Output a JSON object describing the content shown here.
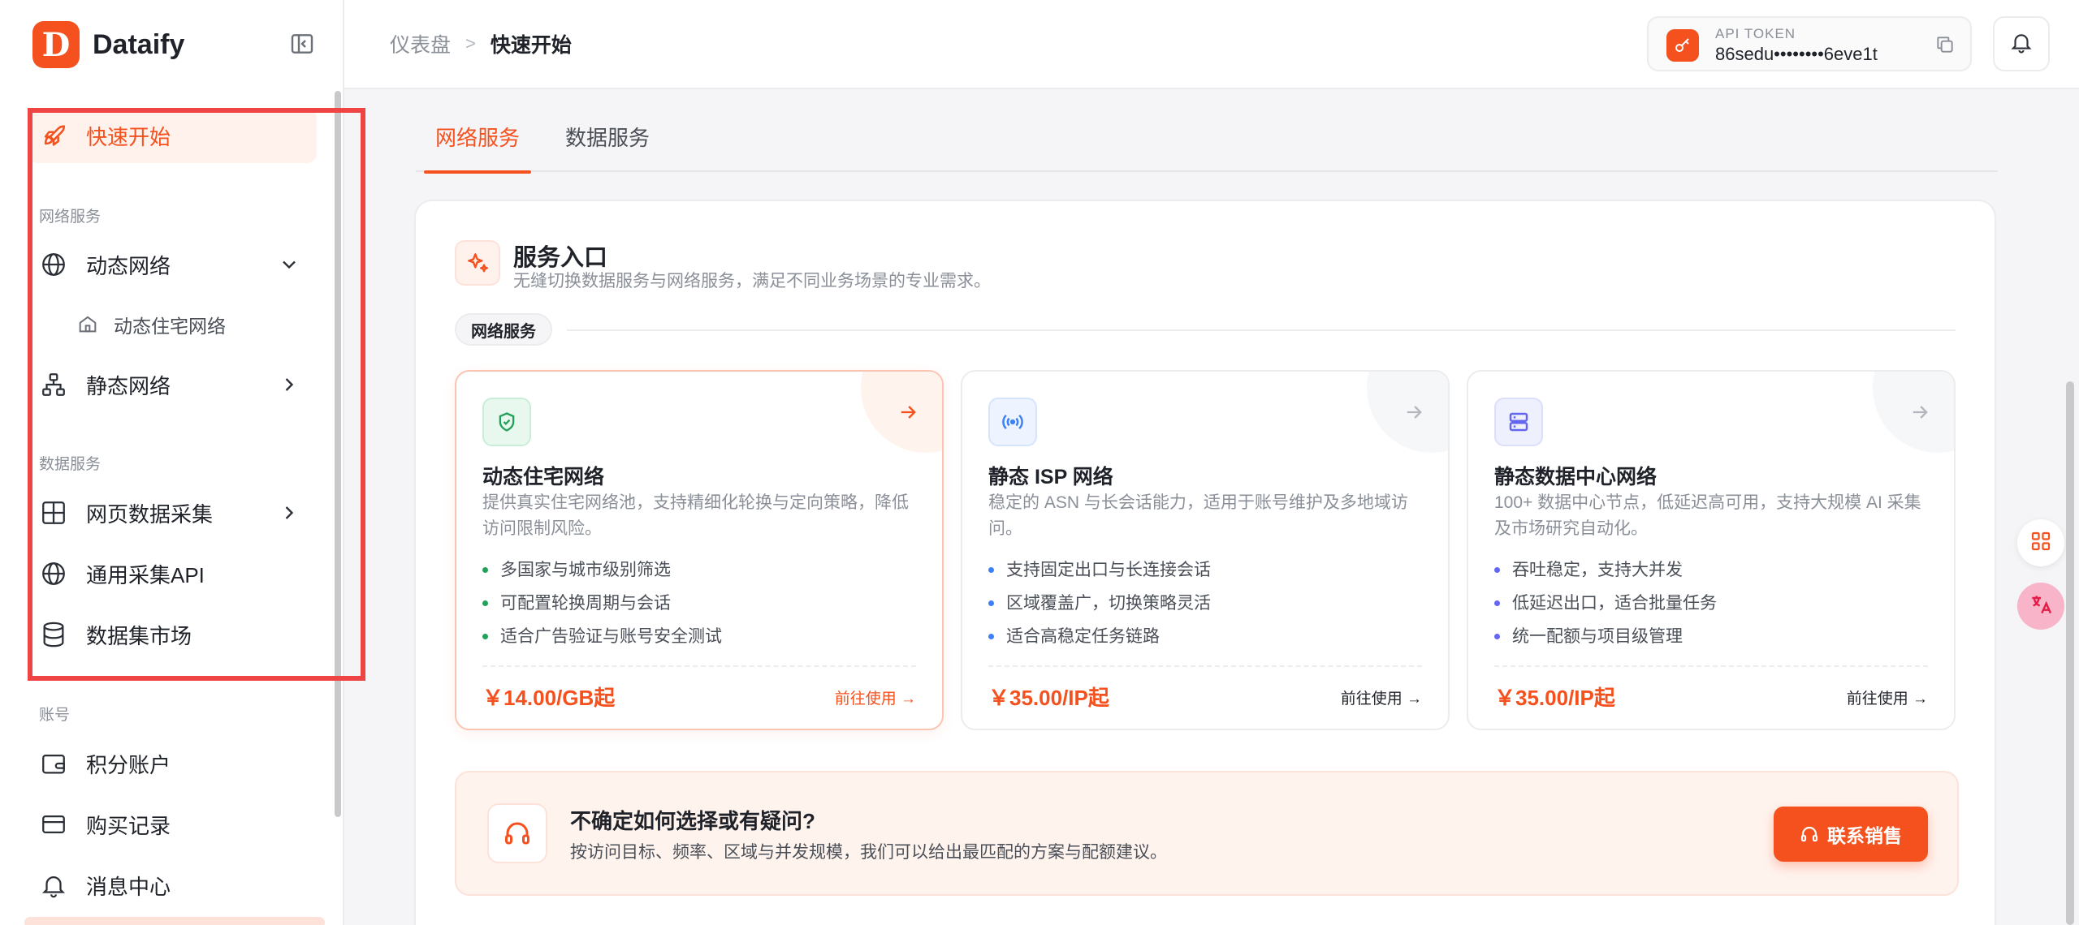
{
  "brand": {
    "logo_letter": "D",
    "name": "Dataify",
    "accent": "#f4511e"
  },
  "sidebar": {
    "quick_start": "快速开始",
    "sections": {
      "network": "网络服务",
      "data": "数据服务",
      "account": "账号"
    },
    "network_items": {
      "dynamic": "动态网络",
      "dynamic_residential": "动态住宅网络",
      "static": "静态网络"
    },
    "data_items": {
      "web_scraping": "网页数据采集",
      "general_api": "通用采集API",
      "dataset_market": "数据集市场"
    },
    "account_items": {
      "points": "积分账户",
      "purchases": "购买记录",
      "messages": "消息中心"
    }
  },
  "topbar": {
    "breadcrumb_parent": "仪表盘",
    "breadcrumb_sep": ">",
    "breadcrumb_current": "快速开始",
    "token_label": "API TOKEN",
    "token_value": "86sedu••••••••6eve1t"
  },
  "tabs": {
    "network": "网络服务",
    "data": "数据服务"
  },
  "service": {
    "title": "服务入口",
    "subtitle": "无缝切换数据服务与网络服务，满足不同业务场景的专业需求。",
    "pill": "网络服务"
  },
  "products": [
    {
      "title": "动态住宅网络",
      "desc": "提供真实住宅网络池，支持精细化轮换与定向策略，降低访问限制风险。",
      "features": [
        "多国家与城市级别筛选",
        "可配置轮换周期与会话",
        "适合广告验证与账号安全测试"
      ],
      "price": "￥14.00/GB起",
      "link": "前往使用 →",
      "icon": "shield-icon",
      "dot_color": "#22a15a"
    },
    {
      "title": "静态 ISP 网络",
      "desc": "稳定的 ASN 与长会话能力，适用于账号维护及多地域访问。",
      "features": [
        "支持固定出口与长连接会话",
        "区域覆盖广，切换策略灵活",
        "适合高稳定任务链路"
      ],
      "price": "￥35.00/IP起",
      "link": "前往使用 →",
      "icon": "broadcast-icon",
      "dot_color": "#3b82f6"
    },
    {
      "title": "静态数据中心网络",
      "desc": "100+ 数据中心节点，低延迟高可用，支持大规模 AI 采集及市场研究自动化。",
      "features": [
        "吞吐稳定，支持大并发",
        "低延迟出口，适合批量任务",
        "统一配额与项目级管理"
      ],
      "price": "￥35.00/IP起",
      "link": "前往使用 →",
      "icon": "server-icon",
      "dot_color": "#6366f1"
    }
  ],
  "help": {
    "title": "不确定如何选择或有疑问?",
    "subtitle": "按访问目标、频率、区域与并发规模，我们可以给出最匹配的方案与配额建议。",
    "button": "联系销售"
  }
}
